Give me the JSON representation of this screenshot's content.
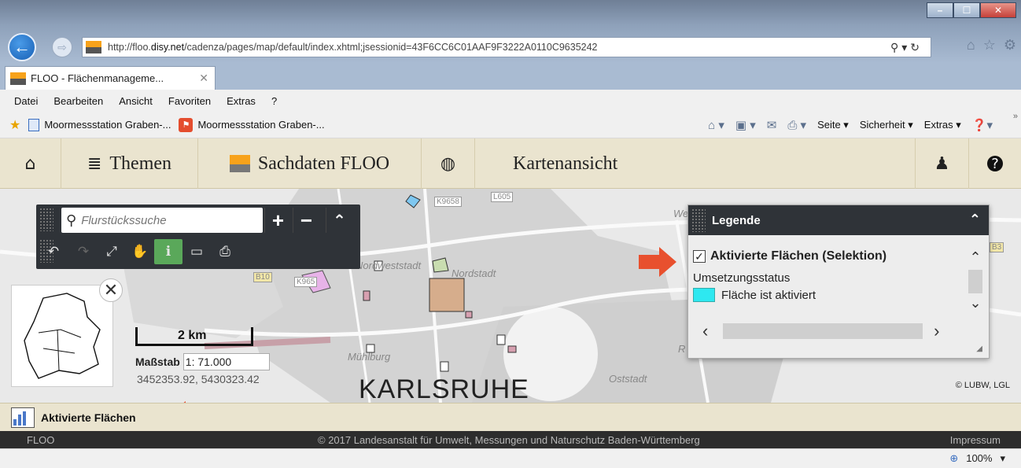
{
  "browser": {
    "url_prefix": "http://floo.",
    "url_domain": "disy.net",
    "url_rest": "/cadenza/pages/map/default/index.xhtml;jsessionid=43F6CC6C01AAF9F3222A0110C9635242",
    "tab_title": "FLOO - Flächenmanageme...",
    "menu": [
      "Datei",
      "Bearbeiten",
      "Ansicht",
      "Favoriten",
      "Extras",
      "?"
    ],
    "favorites": [
      "Moormessstation Graben-...",
      "Moormessstation Graben-..."
    ],
    "commands": {
      "seite": "Seite ▾",
      "sicherheit": "Sicherheit ▾",
      "extras": "Extras ▾"
    },
    "zoom": "100%"
  },
  "nav": {
    "themen": "Themen",
    "sachdaten": "Sachdaten FLOO",
    "kartenansicht": "Kartenansicht"
  },
  "map": {
    "search_placeholder": "Flurstückssuche",
    "scale_label": "2 km",
    "massstab_label": "Maßstab",
    "massstab_value": "1: 71.000",
    "coords": "3452353.92, 5430323.42",
    "city": "KARLSRUHE",
    "attribution": "© LUBW, LGL",
    "place_labels": [
      "Nordweststadt",
      "Nordstadt",
      "Mühlburg",
      "Oststadt",
      "K9658",
      "L605",
      "B10",
      "K965",
      "We",
      "B3",
      "R"
    ]
  },
  "legend": {
    "title": "Legende",
    "layer": "Aktivierte Flächen (Selektion)",
    "status_label": "Umsetzungsstatus",
    "entry": "Fläche ist aktiviert",
    "swatch_color": "#2ee8f0"
  },
  "results": {
    "label": "Aktivierte Flächen"
  },
  "footer": {
    "left": "FLOO",
    "center": "© 2017 Landesanstalt für Umwelt, Messungen und Naturschutz Baden-Württemberg",
    "right": "Impressum"
  }
}
